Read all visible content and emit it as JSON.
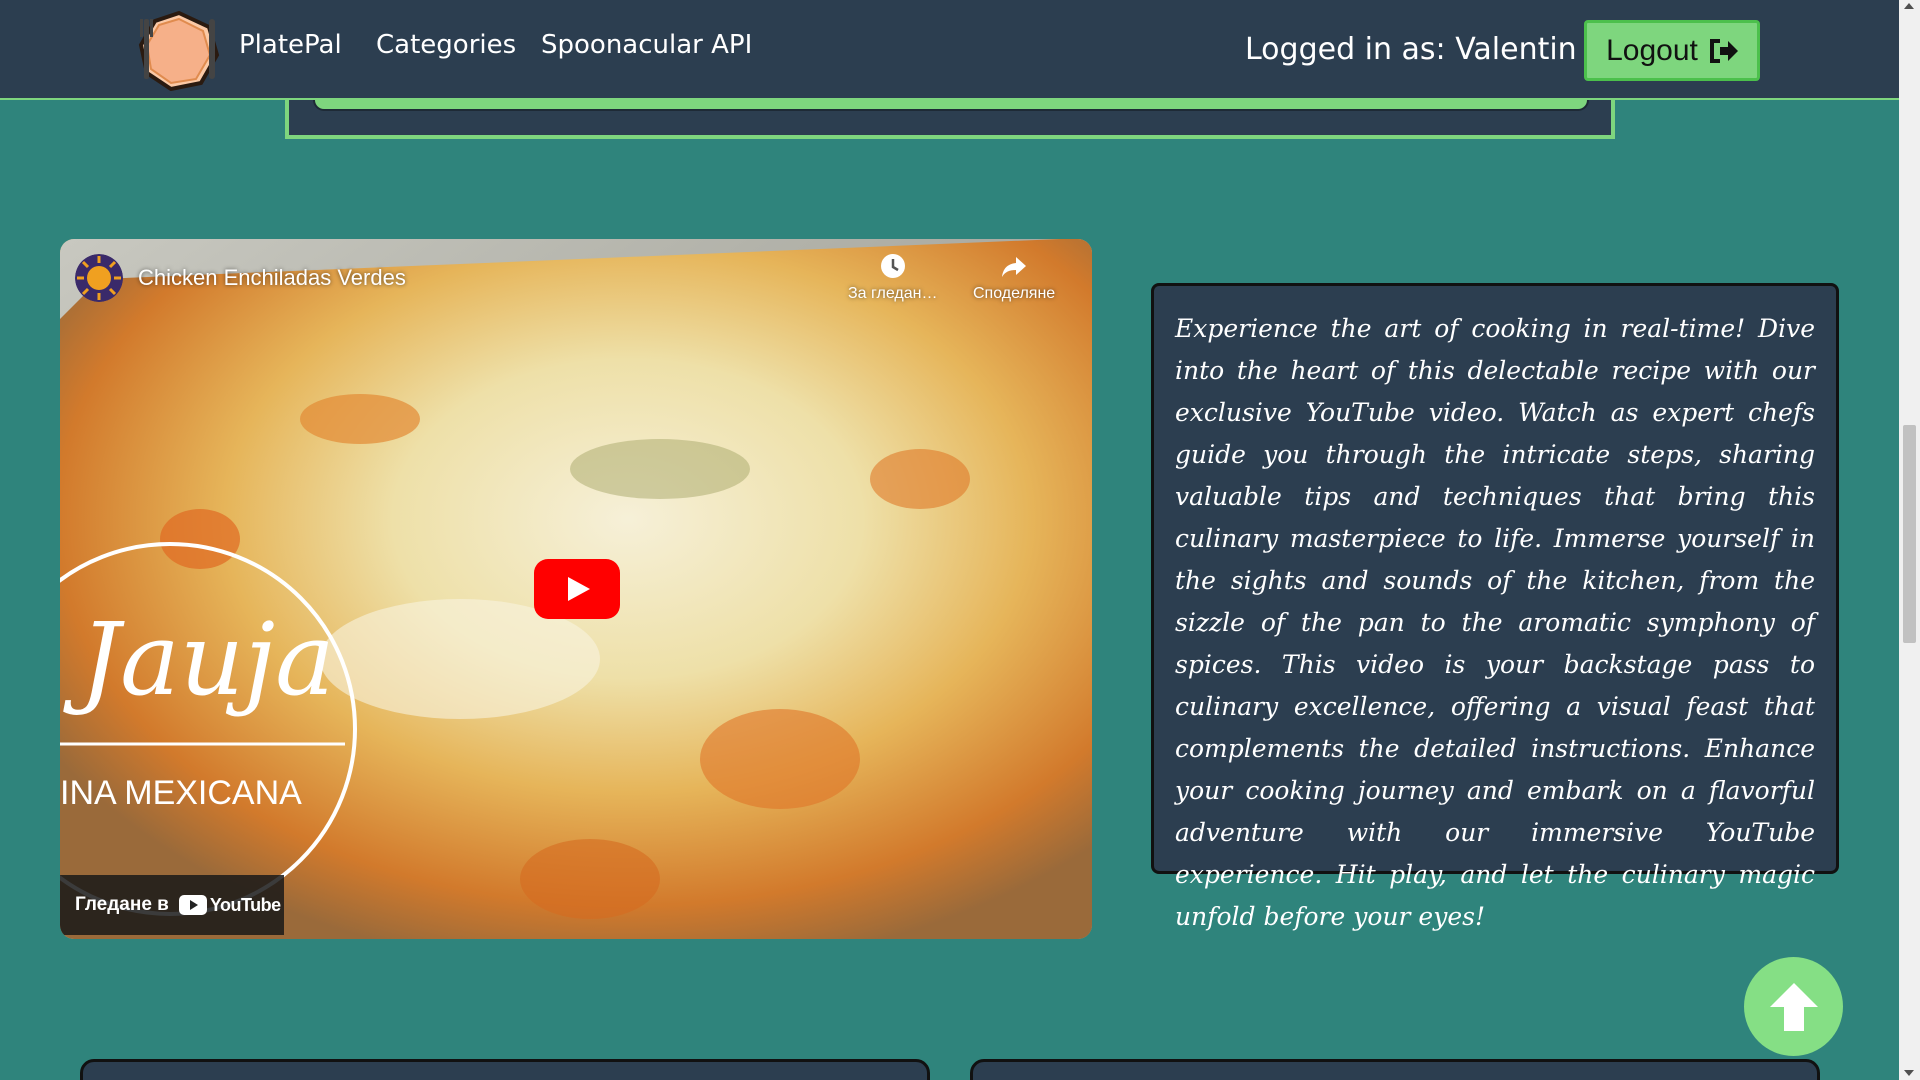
{
  "colors": {
    "navbar_bg": "#2c3e50",
    "page_bg": "#2f847c",
    "accent_green": "#7ed67e",
    "youtube_red": "#ff0000"
  },
  "navbar": {
    "brand": "PlatePal",
    "links": [
      "Categories",
      "Spoonacular API"
    ],
    "login_text": "Logged in as: Valentin",
    "logout_label": "Logout",
    "logo_icon": "plate-fork-knife-icon",
    "logout_icon": "sign-out-icon"
  },
  "video": {
    "title": "Chicken Enchiladas Verdes",
    "watch_later_label": "За гледан…",
    "share_label": "Споделяне",
    "watch_on_label": "Гледане в",
    "youtube_label": "YouTube",
    "watermark_script": "Jauja",
    "watermark_text": "INA   MEXICANA"
  },
  "description": {
    "text": "Experience the art of cooking in real-time! Dive into the heart of this delectable recipe with our exclusive YouTube video. Watch as expert chefs guide you through the intricate steps, sharing valuable tips and techniques that bring this culinary masterpiece to life. Immerse yourself in the sights and sounds of the kitchen, from the sizzle of the pan to the aromatic symphony of spices. This video is your backstage pass to culinary excellence, offering a visual feast that complements the detailed instructions. Enhance your cooking journey and embark on a flavorful adventure with our immersive YouTube experience. Hit play, and let the culinary magic unfold before your eyes!"
  },
  "scroll_top": {
    "icon": "arrow-up-icon"
  }
}
